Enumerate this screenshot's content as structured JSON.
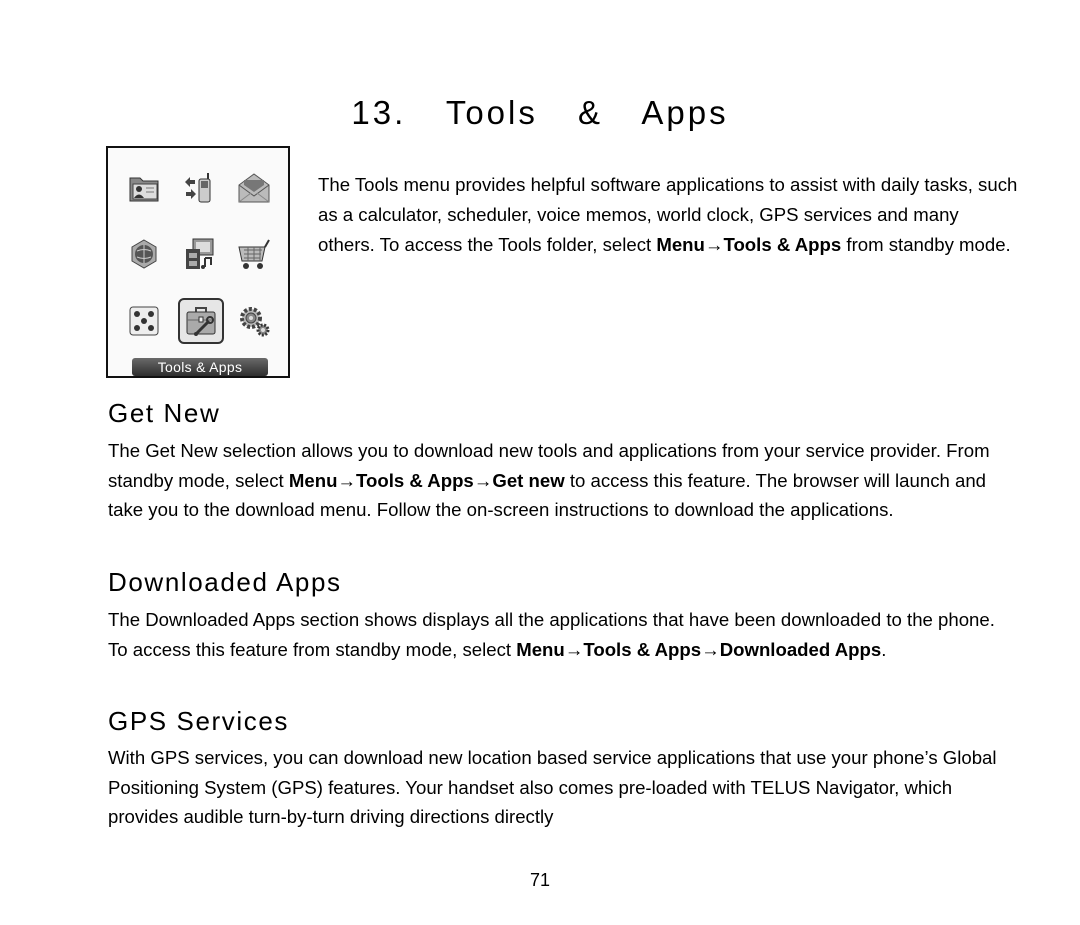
{
  "chapter": {
    "number": "13.",
    "title": "Tools & Apps"
  },
  "phone_screen": {
    "selected_label": "Tools & Apps",
    "icons": [
      {
        "name": "contacts-icon"
      },
      {
        "name": "phone-transfer-icon"
      },
      {
        "name": "messaging-icon"
      },
      {
        "name": "web-globe-icon"
      },
      {
        "name": "media-icon"
      },
      {
        "name": "shopping-cart-icon"
      },
      {
        "name": "games-dice-icon"
      },
      {
        "name": "tools-toolbox-icon",
        "selected": true
      },
      {
        "name": "settings-gears-icon"
      }
    ]
  },
  "intro": {
    "text": "The Tools menu provides helpful software applications to assist with daily tasks, such as a calculator, scheduler, voice memos, world clock, GPS services and many others. To access the Tools folder, select ",
    "bold": "Menu→Tools & Apps",
    "tail": " from standby mode."
  },
  "sections": [
    {
      "heading": "Get New",
      "text_before": "The Get New selection allows you to download new tools and applications from your service provider. From standby mode, select ",
      "bold": "Menu→Tools & Apps→Get new",
      "text_after": " to access this feature. The browser will launch and take you to the download menu. Follow the on-screen instructions to download the applications."
    },
    {
      "heading": "Downloaded Apps",
      "text_before": "The Downloaded Apps section shows displays all the applications that have been downloaded to the phone. To access this feature from standby mode, select ",
      "bold": "Menu→Tools & Apps→Downloaded Apps",
      "text_after": "."
    },
    {
      "heading": "GPS Services",
      "text_before": "With GPS services, you can download new location based service applications that use your phone’s Global Positioning System (GPS) features. Your handset also comes pre-loaded with TELUS Navigator, which provides audible turn-by-turn driving directions directly",
      "bold": "",
      "text_after": ""
    }
  ],
  "page_number": "71"
}
